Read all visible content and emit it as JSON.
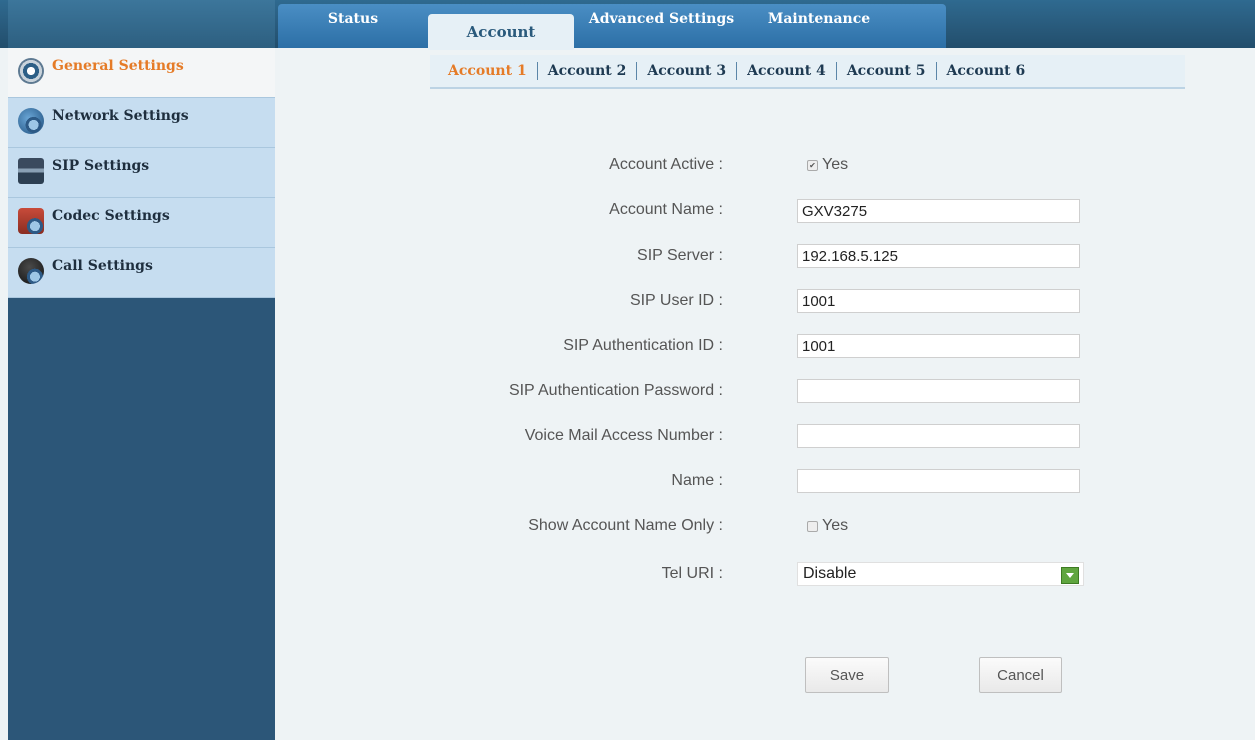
{
  "top_tabs": [
    "Status",
    "Account",
    "Advanced Settings",
    "Maintenance"
  ],
  "sidebar": {
    "items": [
      {
        "label": "General Settings",
        "icon": "gear-icon"
      },
      {
        "label": "Network Settings",
        "icon": "globe-icon"
      },
      {
        "label": "SIP Settings",
        "icon": "sip-icon"
      },
      {
        "label": "Codec Settings",
        "icon": "codec-icon"
      },
      {
        "label": "Call Settings",
        "icon": "phone-icon"
      }
    ]
  },
  "sub_tabs": [
    "Account 1",
    "Account 2",
    "Account 3",
    "Account 4",
    "Account 5",
    "Account 6"
  ],
  "form": {
    "account_active": {
      "label": "Account Active :",
      "value": "Yes",
      "checked": true
    },
    "account_name": {
      "label": "Account Name :",
      "value": "GXV3275"
    },
    "sip_server": {
      "label": "SIP Server :",
      "value": "192.168.5.125"
    },
    "sip_user_id": {
      "label": "SIP User ID :",
      "value": "1001"
    },
    "sip_auth_id": {
      "label": "SIP Authentication ID :",
      "value": "1001"
    },
    "sip_auth_password": {
      "label": "SIP Authentication Password :",
      "value": ""
    },
    "voicemail_number": {
      "label": "Voice Mail Access Number :",
      "value": ""
    },
    "name": {
      "label": "Name :",
      "value": ""
    },
    "show_account_name_only": {
      "label": "Show Account Name Only :",
      "value": "Yes",
      "checked": false
    },
    "tel_uri": {
      "label": "Tel URI :",
      "value": "Disable"
    }
  },
  "buttons": {
    "save": "Save",
    "cancel": "Cancel"
  },
  "colors": {
    "accent": "#e57b27",
    "sidebar_dark": "#2c5678",
    "sidebar_light": "#c6ddf0",
    "select_arrow": "#5fa53e"
  }
}
